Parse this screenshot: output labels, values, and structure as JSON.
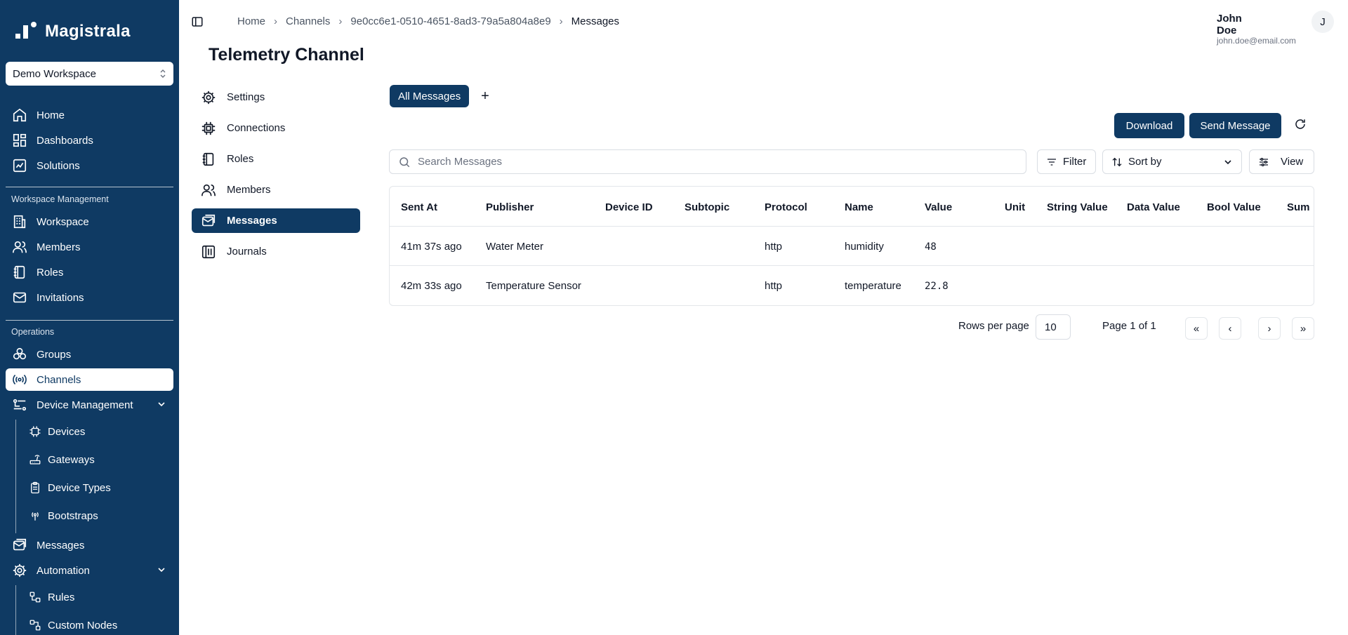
{
  "app": {
    "name": "Magistrala"
  },
  "workspace": {
    "selected": "Demo Workspace"
  },
  "sidebar": {
    "top_items": [
      {
        "label": "Home",
        "icon": "home-icon"
      },
      {
        "label": "Dashboards",
        "icon": "dashboard-icon"
      },
      {
        "label": "Solutions",
        "icon": "solutions-icon"
      }
    ],
    "workspace_section": {
      "label": "Workspace Management",
      "items": [
        {
          "label": "Workspace",
          "icon": "building-icon"
        },
        {
          "label": "Members",
          "icon": "users-icon"
        },
        {
          "label": "Roles",
          "icon": "notebook-icon"
        },
        {
          "label": "Invitations",
          "icon": "mail-icon"
        }
      ]
    },
    "operations_section": {
      "label": "Operations",
      "items": [
        {
          "label": "Groups",
          "icon": "groups-icon"
        },
        {
          "label": "Channels",
          "icon": "radio-icon",
          "active": true
        },
        {
          "label": "Device Management",
          "icon": "device-management-icon",
          "expanded": true
        },
        {
          "label": "Messages",
          "icon": "messages-icon"
        },
        {
          "label": "Automation",
          "icon": "gear-icon",
          "expanded": true
        }
      ],
      "device_sub": [
        {
          "label": "Devices",
          "icon": "chip-icon"
        },
        {
          "label": "Gateways",
          "icon": "router-icon"
        },
        {
          "label": "Device Types",
          "icon": "clipboard-icon"
        },
        {
          "label": "Bootstraps",
          "icon": "radio-icon"
        }
      ],
      "automation_sub": [
        {
          "label": "Rules",
          "icon": "workflow-icon"
        },
        {
          "label": "Custom Nodes",
          "icon": "nodes-icon"
        }
      ]
    }
  },
  "breadcrumb": [
    "Home",
    "Channels",
    "9e0cc6e1-0510-4651-8ad3-79a5a804a8e9",
    "Messages"
  ],
  "user": {
    "name": "John Doe",
    "email": "john.doe@email.com",
    "initial": "J"
  },
  "page": {
    "title": "Telemetry Channel"
  },
  "subnav": [
    {
      "label": "Settings",
      "icon": "gear-icon"
    },
    {
      "label": "Connections",
      "icon": "chip-icon"
    },
    {
      "label": "Roles",
      "icon": "notebook-icon"
    },
    {
      "label": "Members",
      "icon": "users-icon"
    },
    {
      "label": "Messages",
      "icon": "messages-icon",
      "active": true
    },
    {
      "label": "Journals",
      "icon": "journals-icon"
    }
  ],
  "tabs": {
    "all_label": "All Messages",
    "add_label": "+"
  },
  "actions": {
    "download": "Download",
    "send": "Send Message"
  },
  "search": {
    "placeholder": "Search Messages"
  },
  "toolbar": {
    "filter": "Filter",
    "sort": "Sort by",
    "view": "View"
  },
  "table": {
    "columns": [
      "Sent At",
      "Publisher",
      "Device ID",
      "Subtopic",
      "Protocol",
      "Name",
      "Value",
      "Unit",
      "String Value",
      "Data Value",
      "Bool Value",
      "Sum"
    ],
    "rows": [
      {
        "sent_at": "41m 37s ago",
        "publisher": "Water Meter",
        "device_id": "",
        "subtopic": "",
        "protocol": "http",
        "name": "humidity",
        "value": "48",
        "unit": "",
        "string_value": "",
        "data_value": "",
        "bool_value": "",
        "sum": ""
      },
      {
        "sent_at": "42m 33s ago",
        "publisher": "Temperature Sensor",
        "device_id": "",
        "subtopic": "",
        "protocol": "http",
        "name": "temperature",
        "value": "22.8",
        "unit": "",
        "string_value": "",
        "data_value": "",
        "bool_value": "",
        "sum": ""
      }
    ]
  },
  "pagination": {
    "rows_per_page_label": "Rows per page",
    "rows_per_page": "10",
    "page_info": "Page 1 of 1",
    "first": "«",
    "prev": "‹",
    "next": "›",
    "last": "»"
  },
  "colors": {
    "primary": "#0f3a63",
    "background": "#ffffff",
    "border": "#e3e6ea"
  }
}
